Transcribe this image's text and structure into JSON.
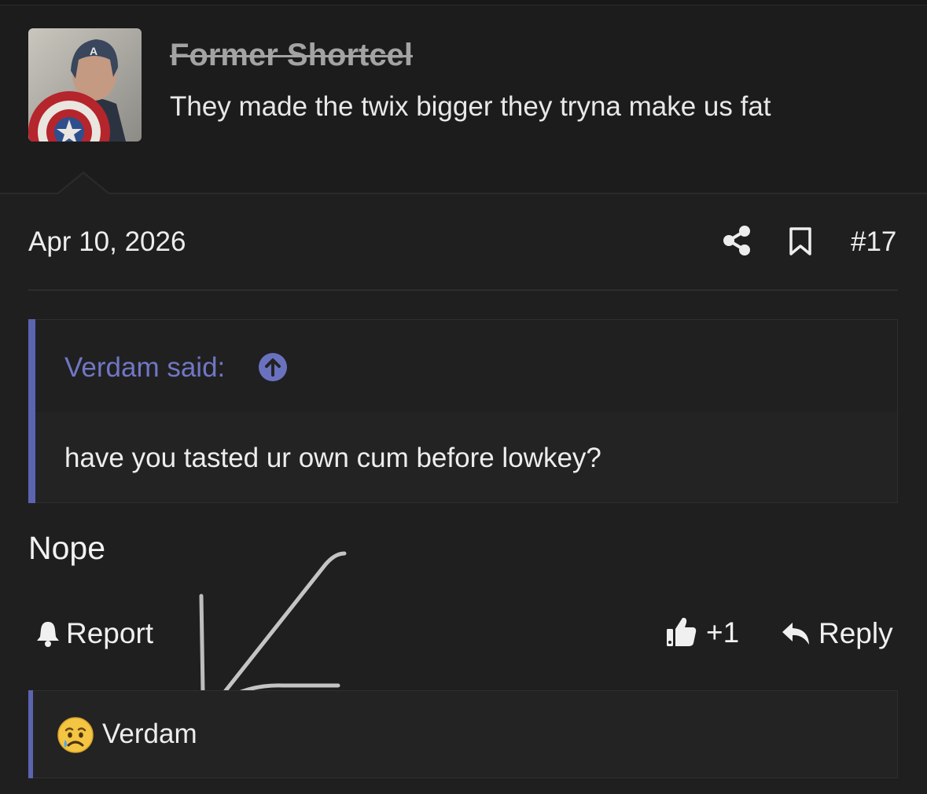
{
  "post": {
    "username": "Former Shortcel",
    "signature": "They made the twix bigger they tryna make us fat",
    "date": "Apr 10, 2026",
    "post_number": "#17",
    "message": "Nope"
  },
  "quote": {
    "author_label": "Verdam said:",
    "body": "have you tasted ur own cum before lowkey?"
  },
  "actions": {
    "report_label": "Report",
    "like_count": "+1",
    "reply_label": "Reply"
  },
  "reactions": {
    "reactor": "Verdam",
    "emoji": "sad-tear-face"
  },
  "icons": [
    "share-icon",
    "bookmark-icon",
    "arrow-up-circle-icon",
    "bell-icon",
    "thumbs-up-icon",
    "reply-icon"
  ],
  "colors": {
    "background": "#1f1f20",
    "accent": "#5b64b0",
    "quote_author": "#7077c4",
    "username_muted": "#a3a3a3"
  }
}
